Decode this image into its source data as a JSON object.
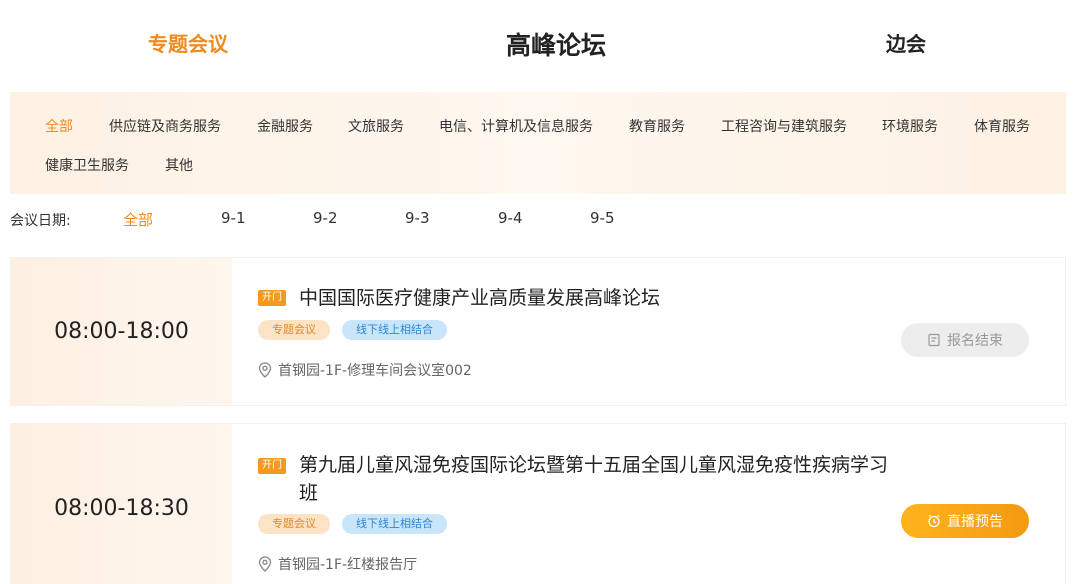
{
  "top_tabs": {
    "tab1": "专题会议",
    "tab2": "高峰论坛",
    "tab3": "边会"
  },
  "categories": {
    "row1": [
      "全部",
      "供应链及商务服务",
      "金融服务",
      "文旅服务",
      "电信、计算机及信息服务",
      "教育服务",
      "工程咨询与建筑服务",
      "环境服务",
      "体育服务"
    ],
    "row2": [
      "健康卫生服务",
      "其他"
    ],
    "active": "全部"
  },
  "dates": {
    "label": "会议日期:",
    "items": [
      "全部",
      "9-1",
      "9-2",
      "9-3",
      "9-4",
      "9-5"
    ],
    "active": "全部"
  },
  "events": [
    {
      "time": "08:00-18:00",
      "badge": "开门",
      "title": "中国国际医疗健康产业高质量发展高峰论坛",
      "tag1": "专题会议",
      "tag2": "线下线上相结合",
      "location": "首钢园-1F-修理车间会议室002",
      "action": "报名结束",
      "action_icon": "form-icon"
    },
    {
      "time": "08:00-18:30",
      "badge": "开门",
      "title": "第九届儿童风湿免疫国际论坛暨第十五届全国儿童风湿免疫性疾病学习班",
      "tag1": "专题会议",
      "tag2": "线下线上相结合",
      "location": "首钢园-1F-红楼报告厅",
      "action": "直播预告",
      "action_icon": "alarm-clock-icon"
    }
  ],
  "colors": {
    "accent": "#f08a1c",
    "tag_blue": "#2f86d0",
    "ended_bg": "#ededed",
    "live_btn": "#f5a316"
  }
}
